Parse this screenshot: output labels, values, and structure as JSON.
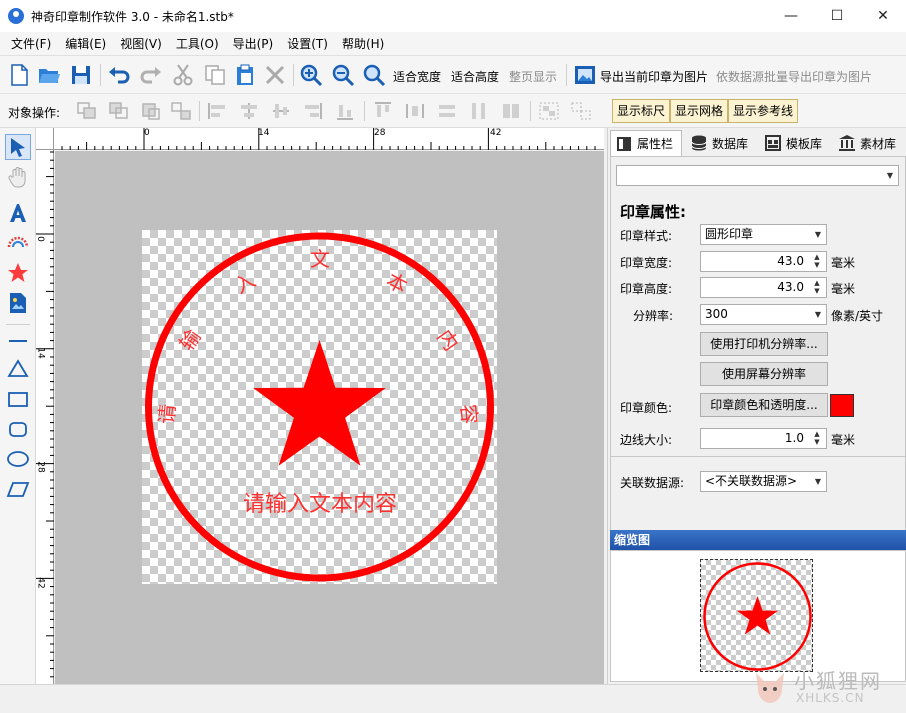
{
  "window": {
    "title": "神奇印章制作软件 3.0 - 未命名1.stb*",
    "minimize": "—",
    "maximize": "☐",
    "close": "✕"
  },
  "menu": [
    "文件(F)",
    "编辑(E)",
    "视图(V)",
    "工具(O)",
    "导出(P)",
    "设置(T)",
    "帮助(H)"
  ],
  "toolbar": {
    "fit_width": "适合宽度",
    "fit_height": "适合高度",
    "full_page": "整页显示",
    "export_current": "导出当前印章为图片",
    "export_batch": "依数据源批量导出印章为图片"
  },
  "object_toolbar": {
    "label": "对象操作:",
    "show_ruler": "显示标尺",
    "show_grid": "显示网格",
    "show_guides": "显示参考线"
  },
  "ruler": {
    "h_ticks": [
      "0",
      "14",
      "28",
      "42"
    ],
    "v_ticks": [
      "0",
      "14",
      "28",
      "42"
    ]
  },
  "stamp": {
    "arc_text": [
      "请",
      "输",
      "入",
      "文",
      "本",
      "内",
      "容"
    ],
    "center_text": "请输入文本内容",
    "color": "#ff0000"
  },
  "panel": {
    "tabs": [
      "属性栏",
      "数据库",
      "模板库",
      "素材库"
    ],
    "object_select": "",
    "section_title": "印章属性:",
    "style_label": "印章样式:",
    "style_value": "圆形印章",
    "width_label": "印章宽度:",
    "width_value": "43.0",
    "height_label": "印章高度:",
    "height_value": "43.0",
    "unit_mm": "毫米",
    "dpi_label": "分辨率:",
    "dpi_value": "300",
    "dpi_unit": "像素/英寸",
    "use_printer_dpi": "使用打印机分辨率...",
    "use_screen_dpi": "使用屏幕分辨率",
    "color_label": "印章颜色:",
    "color_button": "印章颜色和透明度...",
    "color_swatch": "#ff0000",
    "border_label": "边线大小:",
    "border_value": "1.0",
    "datasource_label": "关联数据源:",
    "datasource_value": "<不关联数据源>",
    "preview_title": "缩览图"
  },
  "watermark": {
    "text": "小狐狸网",
    "url": "XHLKS.CN"
  }
}
